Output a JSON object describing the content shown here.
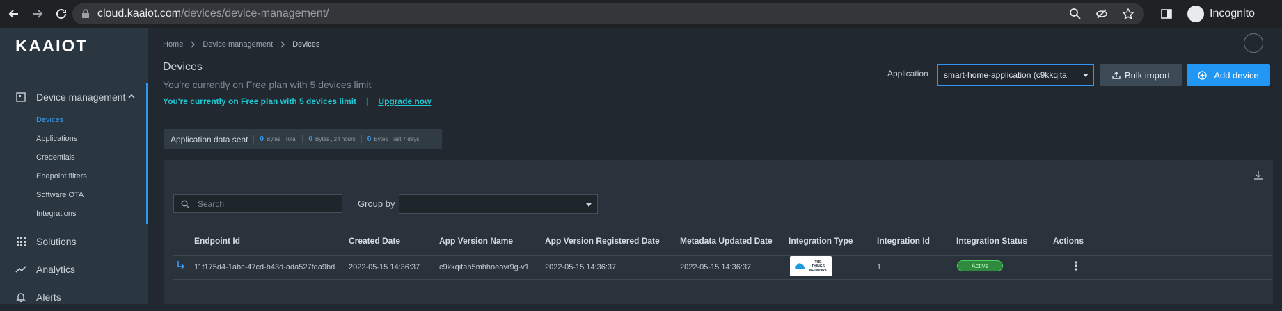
{
  "browser": {
    "url_domain": "cloud.kaaiot.com",
    "url_path": "/devices/device-management/",
    "incognito_label": "Incognito"
  },
  "logo": {
    "text": "KAAIOT"
  },
  "sidebar": {
    "sections": [
      {
        "label": "Device management",
        "icon": "device-icon"
      },
      {
        "label": "Solutions",
        "icon": "grid-icon"
      },
      {
        "label": "Analytics",
        "icon": "analytics-icon"
      },
      {
        "label": "Alerts",
        "icon": "bell-icon"
      }
    ],
    "sub_items": [
      "Devices",
      "Applications",
      "Credentials",
      "Endpoint filters",
      "Software OTA",
      "Integrations"
    ]
  },
  "breadcrumb": [
    "Home",
    "Device management",
    "Devices"
  ],
  "page": {
    "title": "Devices",
    "plan_gray": "You're currently on Free plan with 5 devices limit",
    "plan_notice": "You're currently on Free plan with 5 devices limit",
    "plan_sep": "|",
    "upgrade_label": "Upgrade now"
  },
  "stats": {
    "label": "Application data sent",
    "items": [
      {
        "value": "0",
        "unit": "Bytes , Total"
      },
      {
        "value": "0",
        "unit": "Bytes , 24 hours"
      },
      {
        "value": "0",
        "unit": "Bytes , last 7 days"
      }
    ]
  },
  "toolbar": {
    "application_label": "Application",
    "application_value": "smart-home-application (c9kkqita",
    "bulk_import_label": "Bulk import",
    "add_device_label": "Add device"
  },
  "filters": {
    "search_placeholder": "Search",
    "group_by_label": "Group by",
    "group_by_value": ""
  },
  "table": {
    "headers": [
      "Endpoint Id",
      "Created Date",
      "App Version Name",
      "App Version Registered Date",
      "Metadata Updated Date",
      "Integration Type",
      "Integration Id",
      "Integration Status",
      "Actions"
    ],
    "rows": [
      {
        "endpoint_id": "11f175d4-1abc-47cd-b43d-ada527fda9bd",
        "created_date": "2022-05-15 14:36:37",
        "app_version_name": "c9kkqitah5mhhoeovr9g-v1",
        "app_version_registered_date": "2022-05-15 14:36:37",
        "metadata_updated_date": "2022-05-15 14:36:37",
        "integration_type": "THE THINGS NETWORK",
        "integration_id": "1",
        "integration_status": "Active"
      }
    ]
  },
  "colors": {
    "accent": "#2196f3",
    "sidebar_bg": "#2b3740",
    "main_bg": "#22282f",
    "status_active": "#2e8b3d",
    "plan_notice": "#20c9d4"
  }
}
